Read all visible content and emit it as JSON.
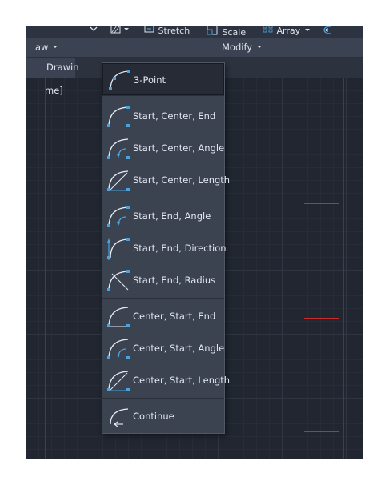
{
  "ribbon": {
    "stretch_label": "Stretch",
    "scale_label": "Scale",
    "array_label": "Array",
    "draw_panel_label": "aw",
    "modify_panel_label": "Modify"
  },
  "tabs": {
    "drawing_tab": "Drawin"
  },
  "viewport": {
    "label": "me]"
  },
  "arc_menu": {
    "items": [
      {
        "label": "3-Point",
        "icon": "arc-3point-icon"
      },
      {
        "label": "Start, Center, End",
        "icon": "arc-start-center-end-icon"
      },
      {
        "label": "Start, Center, Angle",
        "icon": "arc-start-center-angle-icon"
      },
      {
        "label": "Start, Center, Length",
        "icon": "arc-start-center-length-icon"
      },
      {
        "label": "Start, End, Angle",
        "icon": "arc-start-end-angle-icon"
      },
      {
        "label": "Start, End, Direction",
        "icon": "arc-start-end-direction-icon"
      },
      {
        "label": "Start, End, Radius",
        "icon": "arc-start-end-radius-icon"
      },
      {
        "label": "Center, Start, End",
        "icon": "arc-center-start-end-icon"
      },
      {
        "label": "Center, Start, Angle",
        "icon": "arc-center-start-angle-icon"
      },
      {
        "label": "Center, Start, Length",
        "icon": "arc-center-start-length-icon"
      },
      {
        "label": "Continue",
        "icon": "arc-continue-icon"
      }
    ]
  },
  "colors": {
    "accent": "#4aa3df",
    "canvas": "#212630",
    "menu_bg": "#3b4250",
    "marker_red": "#cc2a2a"
  }
}
